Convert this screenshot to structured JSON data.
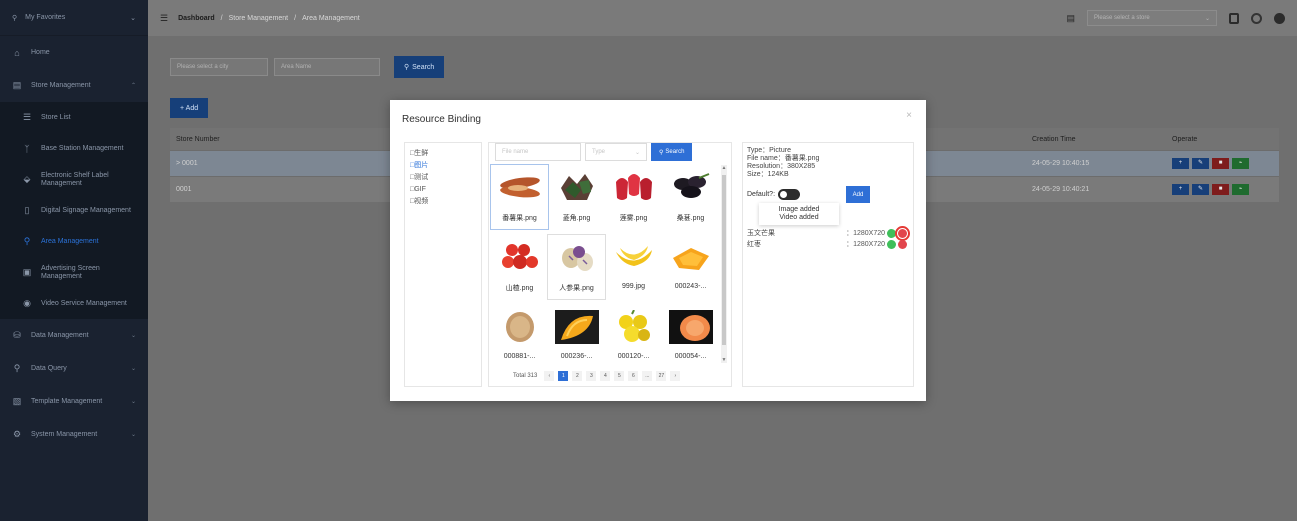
{
  "sidebar": {
    "title": "My Favorites",
    "items": [
      {
        "label": "Home"
      },
      {
        "label": "Store Management"
      },
      {
        "label": "Data Management"
      },
      {
        "label": "Data Query"
      },
      {
        "label": "Template Management"
      },
      {
        "label": "System Management"
      }
    ],
    "sub_items": [
      {
        "label": "Store List"
      },
      {
        "label": "Base Station Management"
      },
      {
        "label": "Electronic Shelf Label Management"
      },
      {
        "label": "Digital Signage Management"
      },
      {
        "label": "Area Management"
      },
      {
        "label": "Advertising Screen Management"
      },
      {
        "label": "Video Service Management"
      }
    ]
  },
  "header": {
    "breadcrumb": [
      "Dashboard",
      "Store Management",
      "Area Management"
    ],
    "store_placeholder": "Please select a store"
  },
  "filters": {
    "city_placeholder": "Please select a city",
    "area_placeholder": "Area Name",
    "search_label": "Search"
  },
  "add_label": "+ Add",
  "table": {
    "headers": [
      "Store Number",
      "Creation Time",
      "Operate"
    ],
    "rows": [
      {
        "number": "> 0001",
        "time": "24-05-29 10:40:15"
      },
      {
        "number": "0001",
        "time": "24-05-29 10:40:21"
      }
    ]
  },
  "modal": {
    "title": "Resource Binding",
    "tree": [
      "□生鲜",
      "□图片",
      "□测试",
      "□GIF",
      "□视频"
    ],
    "file_placeholder": "File name",
    "type_placeholder": "Type",
    "search_label": "Search",
    "images": [
      {
        "name": "番薯果.png"
      },
      {
        "name": "菱角.png"
      },
      {
        "name": "莲雾.png"
      },
      {
        "name": "桑葚.png"
      },
      {
        "name": "山楂.png"
      },
      {
        "name": "人参果.png"
      },
      {
        "name": "999.jpg"
      },
      {
        "name": "000243-..."
      },
      {
        "name": "000881-..."
      },
      {
        "name": "000236-..."
      },
      {
        "name": "000120-..."
      },
      {
        "name": "000054-..."
      }
    ],
    "pager": {
      "total": "Total 313",
      "pages": [
        "1",
        "2",
        "3",
        "4",
        "5",
        "6",
        "...",
        "27"
      ]
    },
    "info": {
      "type": "Type：Picture",
      "file": "File name：番薯果.png",
      "resolution": "Resolution：380X285",
      "size": "Size：124KB",
      "default_label": "Default?:",
      "add_label": "Add",
      "tooltip_1": "Image added",
      "tooltip_2": "Video added"
    },
    "bindings": [
      {
        "name": "玉文芒果",
        "res": "：1280X720"
      },
      {
        "name": "红枣",
        "res": "：1280X720"
      }
    ]
  }
}
